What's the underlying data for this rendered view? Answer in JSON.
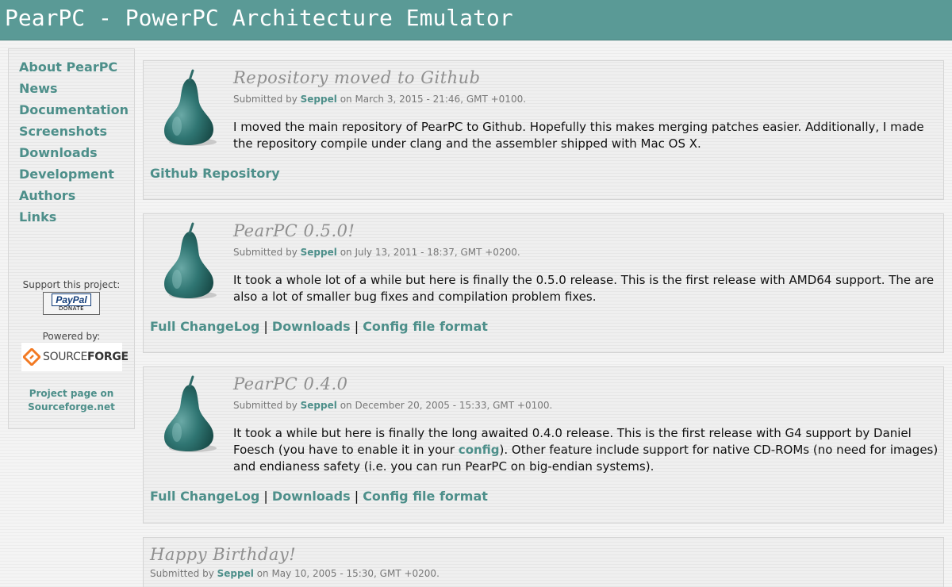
{
  "header": {
    "title": "PearPC - PowerPC Architecture Emulator"
  },
  "sidebar": {
    "nav": [
      "About PearPC",
      "News",
      "Documentation",
      "Screenshots",
      "Downloads",
      "Development",
      "Authors",
      "Links"
    ],
    "support_label": "Support this project:",
    "paypal_text": "PayPal",
    "paypal_donate": "DONATE",
    "powered_label": "Powered by:",
    "sourceforge_text_a": "SOURCE",
    "sourceforge_text_b": "FORGE",
    "project_link_1": "Project page on",
    "project_link_2": "Sourceforge.net"
  },
  "posts": [
    {
      "title": "Repository moved to Github",
      "submitted_by": "Submitted by",
      "author": "Seppel",
      "date": "on March 3, 2015 - 21:46, GMT +0100.",
      "body": "I moved the main repository of PearPC to Github. Hopefully this makes merging patches easier. Additionally, I made the repository compile under clang and the assembler shipped with Mac OS X.",
      "link1": "Github Repository"
    },
    {
      "title": "PearPC 0.5.0!",
      "submitted_by": "Submitted by",
      "author": "Seppel",
      "date": "on July 13, 2011 - 18:37, GMT +0200.",
      "body": "It took a whole lot of a while but here is finally the 0.5.0 release. This is the first release with AMD64 support. The are also a lot of smaller bug fixes and compilation problem fixes.",
      "link1": "Full ChangeLog",
      "sep": "|",
      "link2": "Downloads",
      "link3": "Config file format"
    },
    {
      "title": "PearPC 0.4.0",
      "submitted_by": "Submitted by",
      "author": "Seppel",
      "date": "on December 20, 2005 - 15:33, GMT +0100.",
      "body_a": "It took a while but here is finally the long awaited 0.4.0 release. This is the first release with G4 support by Daniel Foesch (you have to enable it in your ",
      "body_link": "config",
      "body_b": "). Other feature include support for native CD-ROMs (no need for images) and endianess safety (i.e. you can run PearPC on big-endian systems).",
      "link1": "Full ChangeLog",
      "sep": "|",
      "link2": "Downloads",
      "link3": "Config file format"
    },
    {
      "title": "Happy Birthday!",
      "submitted_by": "Submitted by",
      "author": "Seppel",
      "date": "on May 10, 2005 - 15:30, GMT +0200."
    }
  ],
  "colors": {
    "header": "#5a9a96",
    "link": "#4d8f8a",
    "pear": "#2e6e6c"
  },
  "icons": {
    "post_icon": "pear-icon",
    "sourceforge": "sourceforge-logo-icon"
  }
}
